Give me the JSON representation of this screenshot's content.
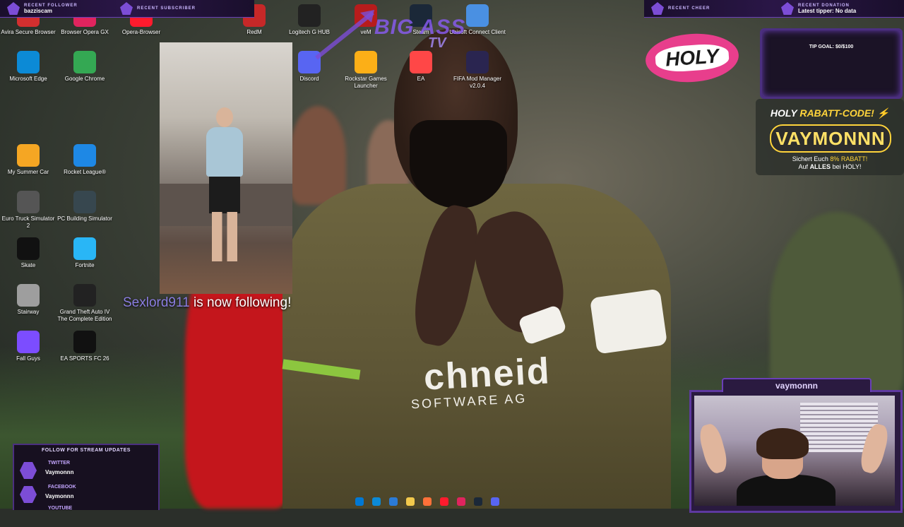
{
  "top_bar": {
    "recent_follower": {
      "label": "RECENT FOLLOWER",
      "value": "bazziscam"
    },
    "recent_subscriber": {
      "label": "RECENT SUBSCRIBER",
      "value": ""
    },
    "recent_cheer": {
      "label": "RECENT CHEER",
      "value": ""
    },
    "recent_donation": {
      "label": "RECENT DONATION",
      "value": "Latest tipper: No data"
    }
  },
  "desktop_icons": [
    {
      "label": "Avira Secure Browser",
      "icon": "avira-icon",
      "color": "#d32f2f"
    },
    {
      "label": "Browser Opera GX",
      "icon": "opera-gx-icon",
      "color": "#e0245e"
    },
    {
      "label": "Opera-Browser",
      "icon": "opera-icon",
      "color": "#ff1b2d"
    },
    {
      "label": "RedM",
      "icon": "redm-icon",
      "color": "#c62828"
    },
    {
      "label": "Logitech G HUB",
      "icon": "logitech-icon",
      "color": "#222222"
    },
    {
      "label": "veM",
      "icon": "vem-icon",
      "color": "#b71c1c"
    },
    {
      "label": "Steam",
      "icon": "steam-icon",
      "color": "#1b2838"
    },
    {
      "label": "Ubisoft Connect Client",
      "icon": "ubisoft-icon",
      "color": "#4a90e2"
    },
    {
      "label": "Microsoft Edge",
      "icon": "edge-icon",
      "color": "#0c8ad6"
    },
    {
      "label": "Google Chrome",
      "icon": "chrome-icon",
      "color": "#34a853"
    },
    {
      "label": "Discord",
      "icon": "discord-icon",
      "color": "#5865f2"
    },
    {
      "label": "Rockstar Games Launcher",
      "icon": "rockstar-icon",
      "color": "#fcaf17"
    },
    {
      "label": "EA",
      "icon": "ea-icon",
      "color": "#ff4747"
    },
    {
      "label": "FIFA Mod Manager v2.0.4",
      "icon": "mm-icon",
      "color": "#2a2550"
    },
    {
      "label": "My Summer Car",
      "icon": "msc-icon",
      "color": "#f5a623"
    },
    {
      "label": "Rocket League®",
      "icon": "rocket-league-icon",
      "color": "#1e88e5"
    },
    {
      "label": "Euro Truck Simulator 2",
      "icon": "ets2-icon",
      "color": "#555555"
    },
    {
      "label": "PC Building Simulator",
      "icon": "pc-building-icon",
      "color": "#37474f"
    },
    {
      "label": "Skate",
      "icon": "skate-icon",
      "color": "#111111"
    },
    {
      "label": "Fortnite",
      "icon": "fortnite-icon",
      "color": "#29b6f6"
    },
    {
      "label": "Stairway",
      "icon": "stairway-icon",
      "color": "#9e9e9e"
    },
    {
      "label": "Grand Theft Auto IV The Complete Edition",
      "icon": "gta4-icon",
      "color": "#222222"
    },
    {
      "label": "Fall Guys",
      "icon": "fall-guys-icon",
      "color": "#7c4dff"
    },
    {
      "label": "EA SPORTS FC 26",
      "icon": "fc26-icon",
      "color": "#111111"
    }
  ],
  "logo_text": {
    "line1": "BIG ASS",
    "line2": "TV"
  },
  "follow_alert": {
    "name": "Sexlord911",
    "message": "is now following!"
  },
  "sponsor": {
    "logo_text": "HOLY",
    "tip_goal": "TIP GOAL: $0/$100",
    "code_title_lead": "HOLY",
    "code_title_rest": "RABATT-CODE!",
    "code": "VAYMONNN",
    "sub_line1_lead": "Sichert Euch",
    "sub_line1_pct": "8% RABATT!",
    "sub_line2_lead": "Auf",
    "sub_line2_bold": "ALLES",
    "sub_line2_tail": "bei HOLY!"
  },
  "follow_panel": {
    "header": "FOLLOW FOR STREAM UPDATES",
    "networks": [
      {
        "name": "TWITTER",
        "user": "Vaymonnn"
      },
      {
        "name": "FACEBOOK",
        "user": "Vaymonnn"
      },
      {
        "name": "YOUTUBE",
        "user": ""
      }
    ]
  },
  "webcam": {
    "streamer_name": "vaymonnn"
  },
  "shirt": {
    "sponsor": "chneid",
    "tagline": "SOFTWARE AG"
  },
  "taskbar_icons": [
    "windows-start-icon",
    "edge-icon",
    "store-icon",
    "file-explorer-icon",
    "firefox-icon",
    "opera-icon",
    "opera-gx-icon",
    "steam-icon",
    "discord-icon"
  ],
  "colors": {
    "accent_purple": "#6a3fb8",
    "holy_pink": "#e83e8c",
    "code_yellow": "#ffd43b"
  }
}
